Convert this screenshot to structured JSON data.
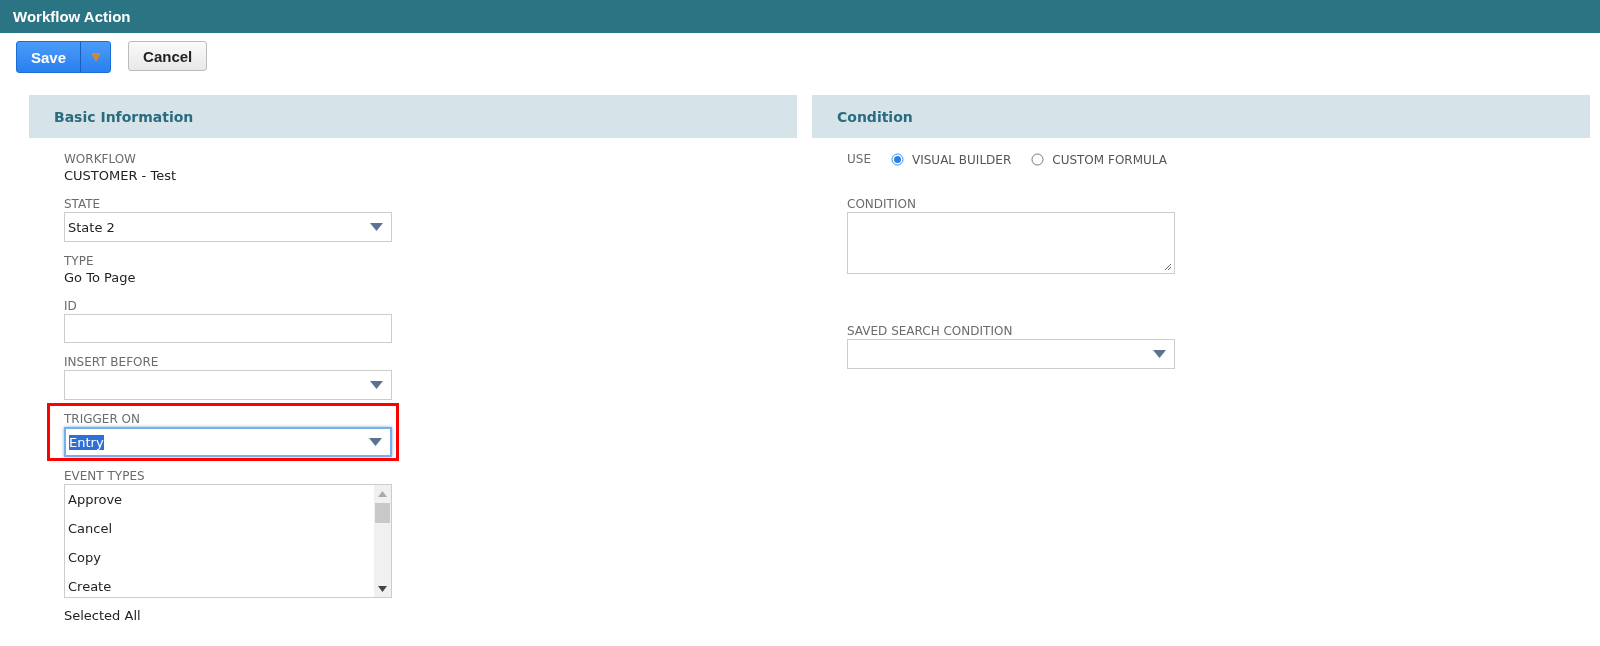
{
  "window": {
    "title": "Workflow Action"
  },
  "toolbar": {
    "buttons": [
      {
        "label": "Save",
        "kind": "primary-split"
      },
      {
        "label": "Cancel",
        "kind": "secondary"
      }
    ]
  },
  "basic_information": {
    "title": "Basic Information",
    "fields": [
      {
        "kind": "text",
        "label": "WORKFLOW",
        "value": "CUSTOMER - Test"
      },
      {
        "kind": "select",
        "label": "STATE",
        "value": "State 2",
        "focused": false,
        "highlighted": false
      },
      {
        "kind": "text",
        "label": "TYPE",
        "value": "Go To Page"
      },
      {
        "kind": "input",
        "label": "ID"
      },
      {
        "kind": "select",
        "label": "INSERT BEFORE",
        "focused": false,
        "highlighted": false
      },
      {
        "kind": "select",
        "label": "TRIGGER ON",
        "value": "Entry",
        "focused": true,
        "highlighted": true
      },
      {
        "kind": "multiselect",
        "label": "EVENT TYPES",
        "options": [
          "Approve",
          "Cancel",
          "Copy",
          "Create"
        ],
        "note": "Selected All"
      }
    ]
  },
  "condition": {
    "title": "Condition",
    "use_label": "USE",
    "use_options": [
      {
        "label": "VISUAL BUILDER",
        "selected": true
      },
      {
        "label": "CUSTOM FORMULA",
        "selected": false
      }
    ],
    "fields": [
      {
        "kind": "textarea",
        "label": "CONDITION"
      },
      {
        "kind": "select",
        "label": "SAVED SEARCH CONDITION",
        "focused": false,
        "highlighted": false
      }
    ]
  }
}
